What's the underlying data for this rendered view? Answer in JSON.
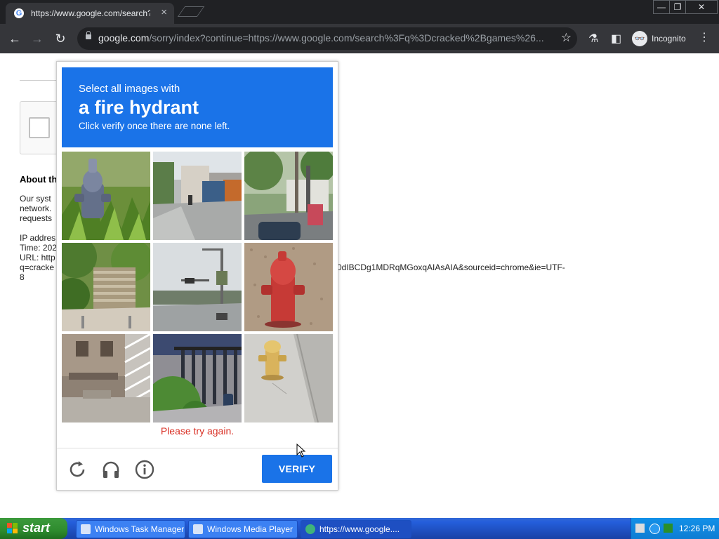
{
  "browser": {
    "tab_title": "https://www.google.com/search?q=",
    "tab_close": "×",
    "url_host": "google.com",
    "url_rest": "/sorry/index?continue=https://www.google.com/search%3Fq%3Dcracked%2Bgames%26...",
    "incognito_label": "Incognito",
    "window_min": "—",
    "window_max": "❐",
    "window_close": "✕"
  },
  "page": {
    "about_heading": "About th",
    "lines": [
      "Our syst",
      "network.",
      "requests"
    ],
    "ip_line": "IP addres",
    "time_line": "Time: 202",
    "url_line": "URL: http",
    "query_line": "q=cracke",
    "url_tail": "0dIBCDg1MDRqMGoxqAIAsAIA&sourceid=chrome&ie=UTF-",
    "url_tail2": "8"
  },
  "captcha": {
    "instruction_line1": "Select all images with",
    "target_object": "a fire hydrant",
    "instruction_line3": "Click verify once there are none left.",
    "tiles": [
      "hydrant-in-grass",
      "street-with-truck",
      "street-with-trees",
      "park-stairs",
      "traffic-light-intersection",
      "red-fire-hydrant",
      "building-with-stairs",
      "gate-with-bush",
      "yellow-fire-hydrant"
    ],
    "error_message": "Please try again.",
    "verify_label": "VERIFY",
    "accent_color": "#1a73e8",
    "error_color": "#d93025"
  },
  "taskbar": {
    "start_label": "start",
    "tasks": [
      "Windows Task Manager",
      "Windows Media Player",
      "https://www.google...."
    ],
    "clock": "12:26 PM"
  }
}
